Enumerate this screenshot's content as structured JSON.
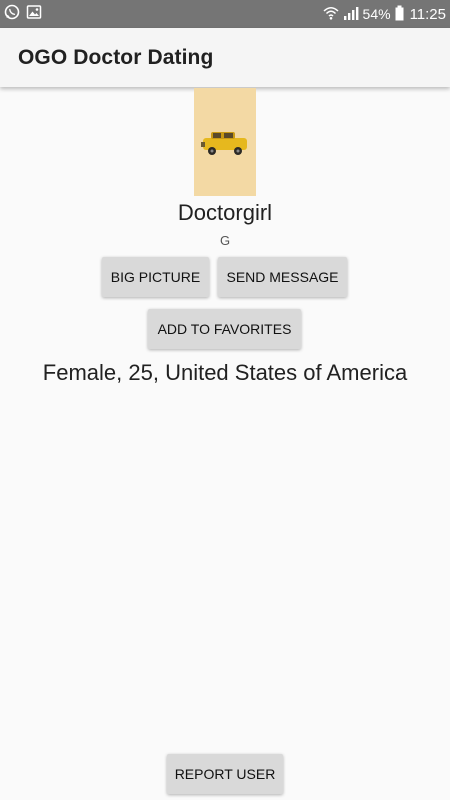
{
  "status_bar": {
    "icons_left": [
      "whatsapp-icon",
      "image-icon"
    ],
    "icons_right": [
      "wifi-icon",
      "signal-icon",
      "battery-icon"
    ],
    "battery_percent": "54%",
    "time": "11:25"
  },
  "app_bar": {
    "title": "OGO Doctor Dating"
  },
  "profile": {
    "name": "Doctorgirl",
    "subtitle": "G",
    "details": "Female, 25, United States of America",
    "photo_background": "#f3d9a4"
  },
  "buttons": {
    "big_picture": "BIG PICTURE",
    "send_message": "SEND MESSAGE",
    "add_to_favorites": "ADD TO FAVORITES",
    "report_user": "REPORT USER"
  },
  "colors": {
    "status_bar": "#757575",
    "app_bar": "#f5f5f5",
    "background": "#fafafa",
    "button": "#d9d9d9"
  }
}
